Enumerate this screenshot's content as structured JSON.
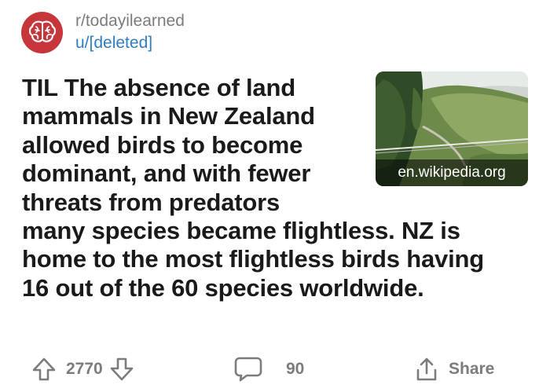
{
  "post": {
    "subreddit": "r/todayilearned",
    "author": "u/[deleted]",
    "title": "TIL The absence of land mammals in New Zealand allowed birds to become dominant, and with fewer threats from predators many species became flightless. NZ is home to the most flightless birds having 16 out of the 60 species worldwide.",
    "link_domain": "en.wikipedia.org",
    "thumbnail_icon": "landscape-thumbnail",
    "subreddit_icon": "brain-icon"
  },
  "actions": {
    "upvote_icon": "upvote-arrow-icon",
    "score": "2770",
    "downvote_icon": "downvote-arrow-icon",
    "comment_icon": "comment-bubble-icon",
    "comments": "90",
    "share_icon": "share-icon",
    "share_label": "Share"
  },
  "colors": {
    "subreddit_avatar": "#c6363b",
    "author_link": "#2f7ec4",
    "muted_text": "#7c7c7c",
    "title_text": "#1a1a1b"
  }
}
